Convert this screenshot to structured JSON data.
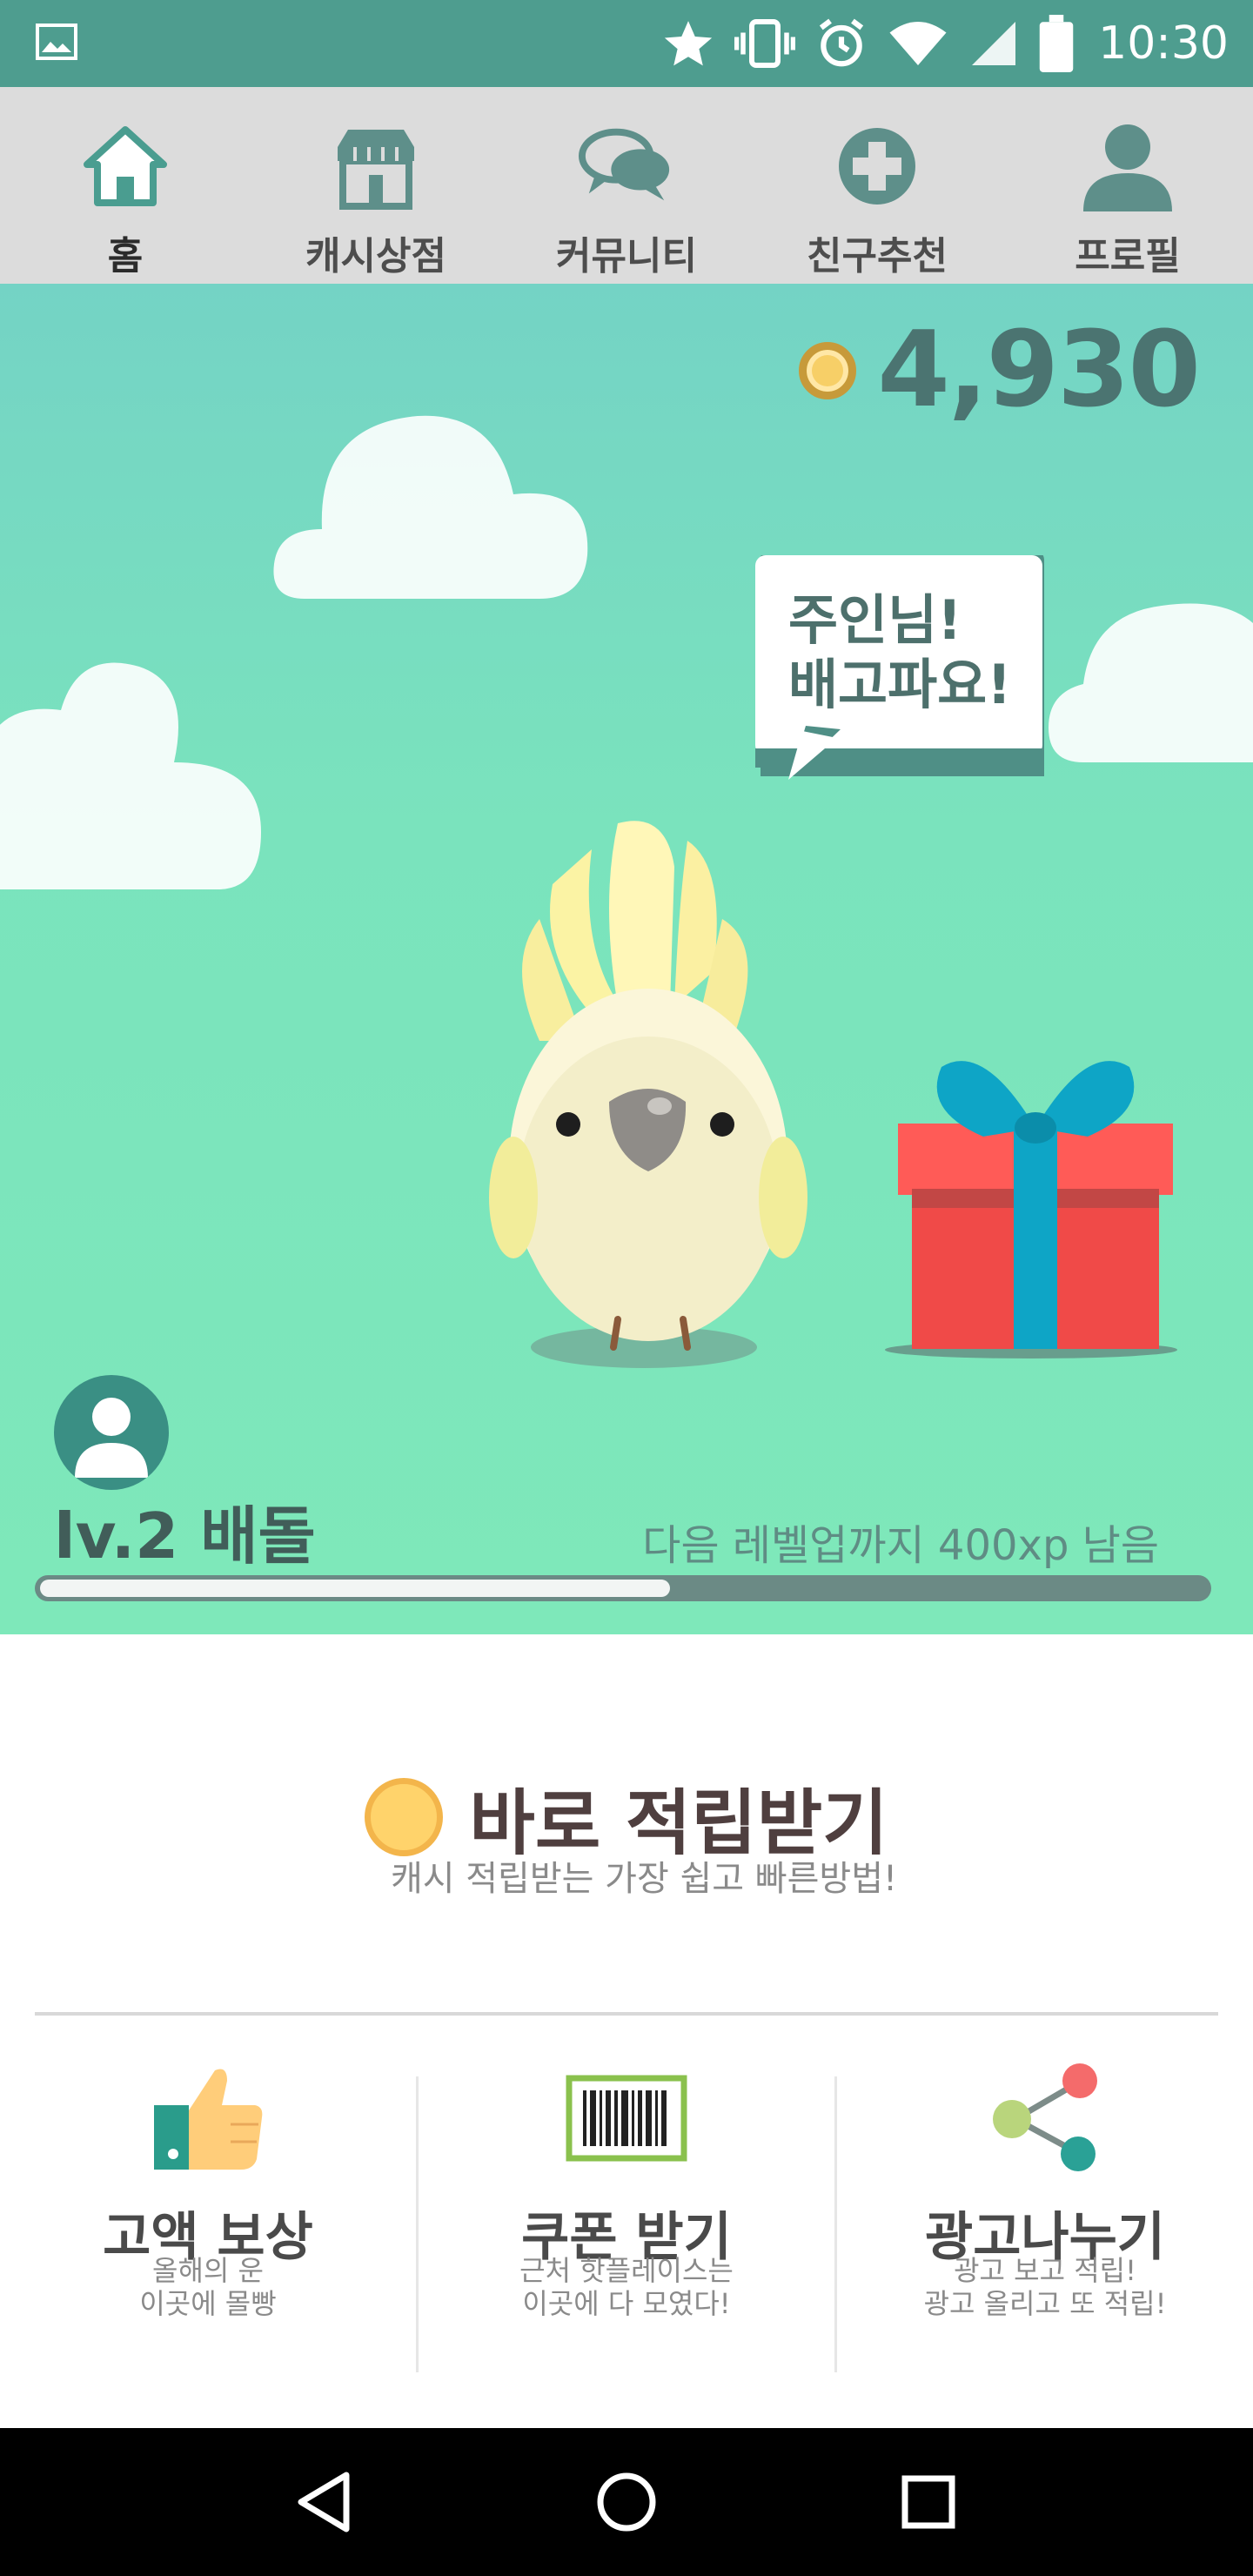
{
  "status_bar": {
    "time": "10:30",
    "icons": [
      "image-icon",
      "star-icon",
      "vibrate-icon",
      "alarm-icon",
      "wifi-icon",
      "signal-icon",
      "battery-icon"
    ]
  },
  "top_nav": {
    "items": [
      {
        "label": "홈",
        "icon": "home-icon",
        "active": true
      },
      {
        "label": "캐시상점",
        "icon": "shop-icon",
        "active": false
      },
      {
        "label": "커뮤니티",
        "icon": "chat-icon",
        "active": false
      },
      {
        "label": "친구추천",
        "icon": "plus-circle-icon",
        "active": false
      },
      {
        "label": "프로필",
        "icon": "user-icon",
        "active": false
      }
    ]
  },
  "scene": {
    "coin_balance": "4,930",
    "speech_line1": "주인님!",
    "speech_line2": "배고파요!",
    "level": "lv.2 배돌",
    "xp_remaining": "다음 레벨업까지 400xp 남음",
    "xp_progress": 0.54
  },
  "instant_reward": {
    "title": "바로 적립받기",
    "subtitle": "캐시 적립받는 가장 쉽고 빠른방법!"
  },
  "features": [
    {
      "title": "고액 보상",
      "desc": "올해의 운\n이곳에 몰빵",
      "icon": "thumbs-up-icon"
    },
    {
      "title": "쿠폰 받기",
      "desc": "근처 핫플레이스는\n이곳에 다 모였다!",
      "icon": "barcode-icon"
    },
    {
      "title": "광고나누기",
      "desc": "광고 보고 적립!\n광고 올리고 또 적립!",
      "icon": "share-icon"
    }
  ],
  "colors": {
    "status_bar": "#4e9d8f",
    "nav_bg": "#dcdcdc",
    "scene_top": "#74d3c5",
    "scene_bottom": "#7ee8ba",
    "accent_dark": "#4b7471"
  }
}
